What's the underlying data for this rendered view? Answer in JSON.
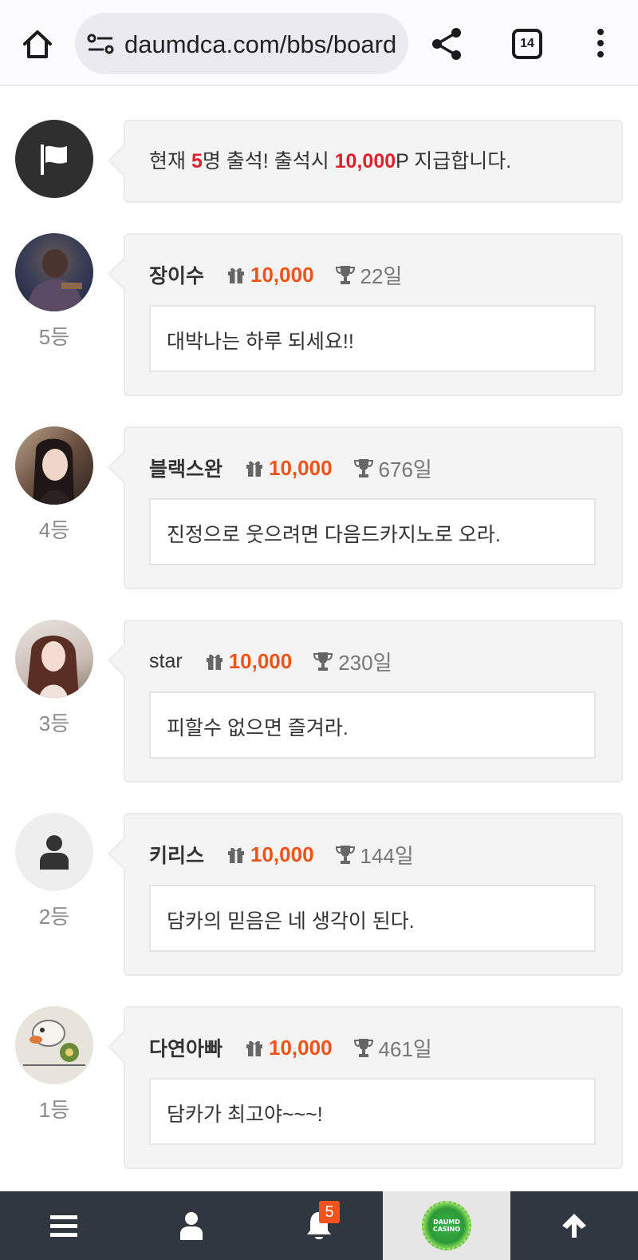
{
  "browser": {
    "url": "daumdca.com/bbs/board",
    "tab_count": "14"
  },
  "notice": {
    "prefix": "현재 ",
    "count": "5",
    "middle": "명 출석! 출석시 ",
    "points": "10,000",
    "suffix": "P 지급합니다."
  },
  "entries": [
    {
      "nickname": "장이수",
      "points": "10,000",
      "days": "22일",
      "message": "대박나는 하루 되세요!!",
      "rank": "5등",
      "avatar": "photo"
    },
    {
      "nickname": "블랙스완",
      "points": "10,000",
      "days": "676일",
      "message": "진정으로 웃으려면 다음드카지노로 오라.",
      "rank": "4등",
      "avatar": "photo"
    },
    {
      "nickname": "star",
      "points": "10,000",
      "days": "230일",
      "message": "피할수 없으면 즐겨라.",
      "rank": "3등",
      "avatar": "photo"
    },
    {
      "nickname": "키리스",
      "points": "10,000",
      "days": "144일",
      "message": "담카의 믿음은 네 생각이 된다.",
      "rank": "2등",
      "avatar": "default-user"
    },
    {
      "nickname": "다연아빠",
      "points": "10,000",
      "days": "461일",
      "message": "담카가 최고야~~~!",
      "rank": "1등",
      "avatar": "photo"
    }
  ],
  "bottom_nav": {
    "notification_count": "5",
    "logo_text_top": "DAUMD",
    "logo_text_bottom": "CASINO"
  },
  "colors": {
    "notice_highlight": "#e0202d",
    "points": "#ef5317",
    "nav_background": "#313740",
    "badge": "#f2521b"
  }
}
